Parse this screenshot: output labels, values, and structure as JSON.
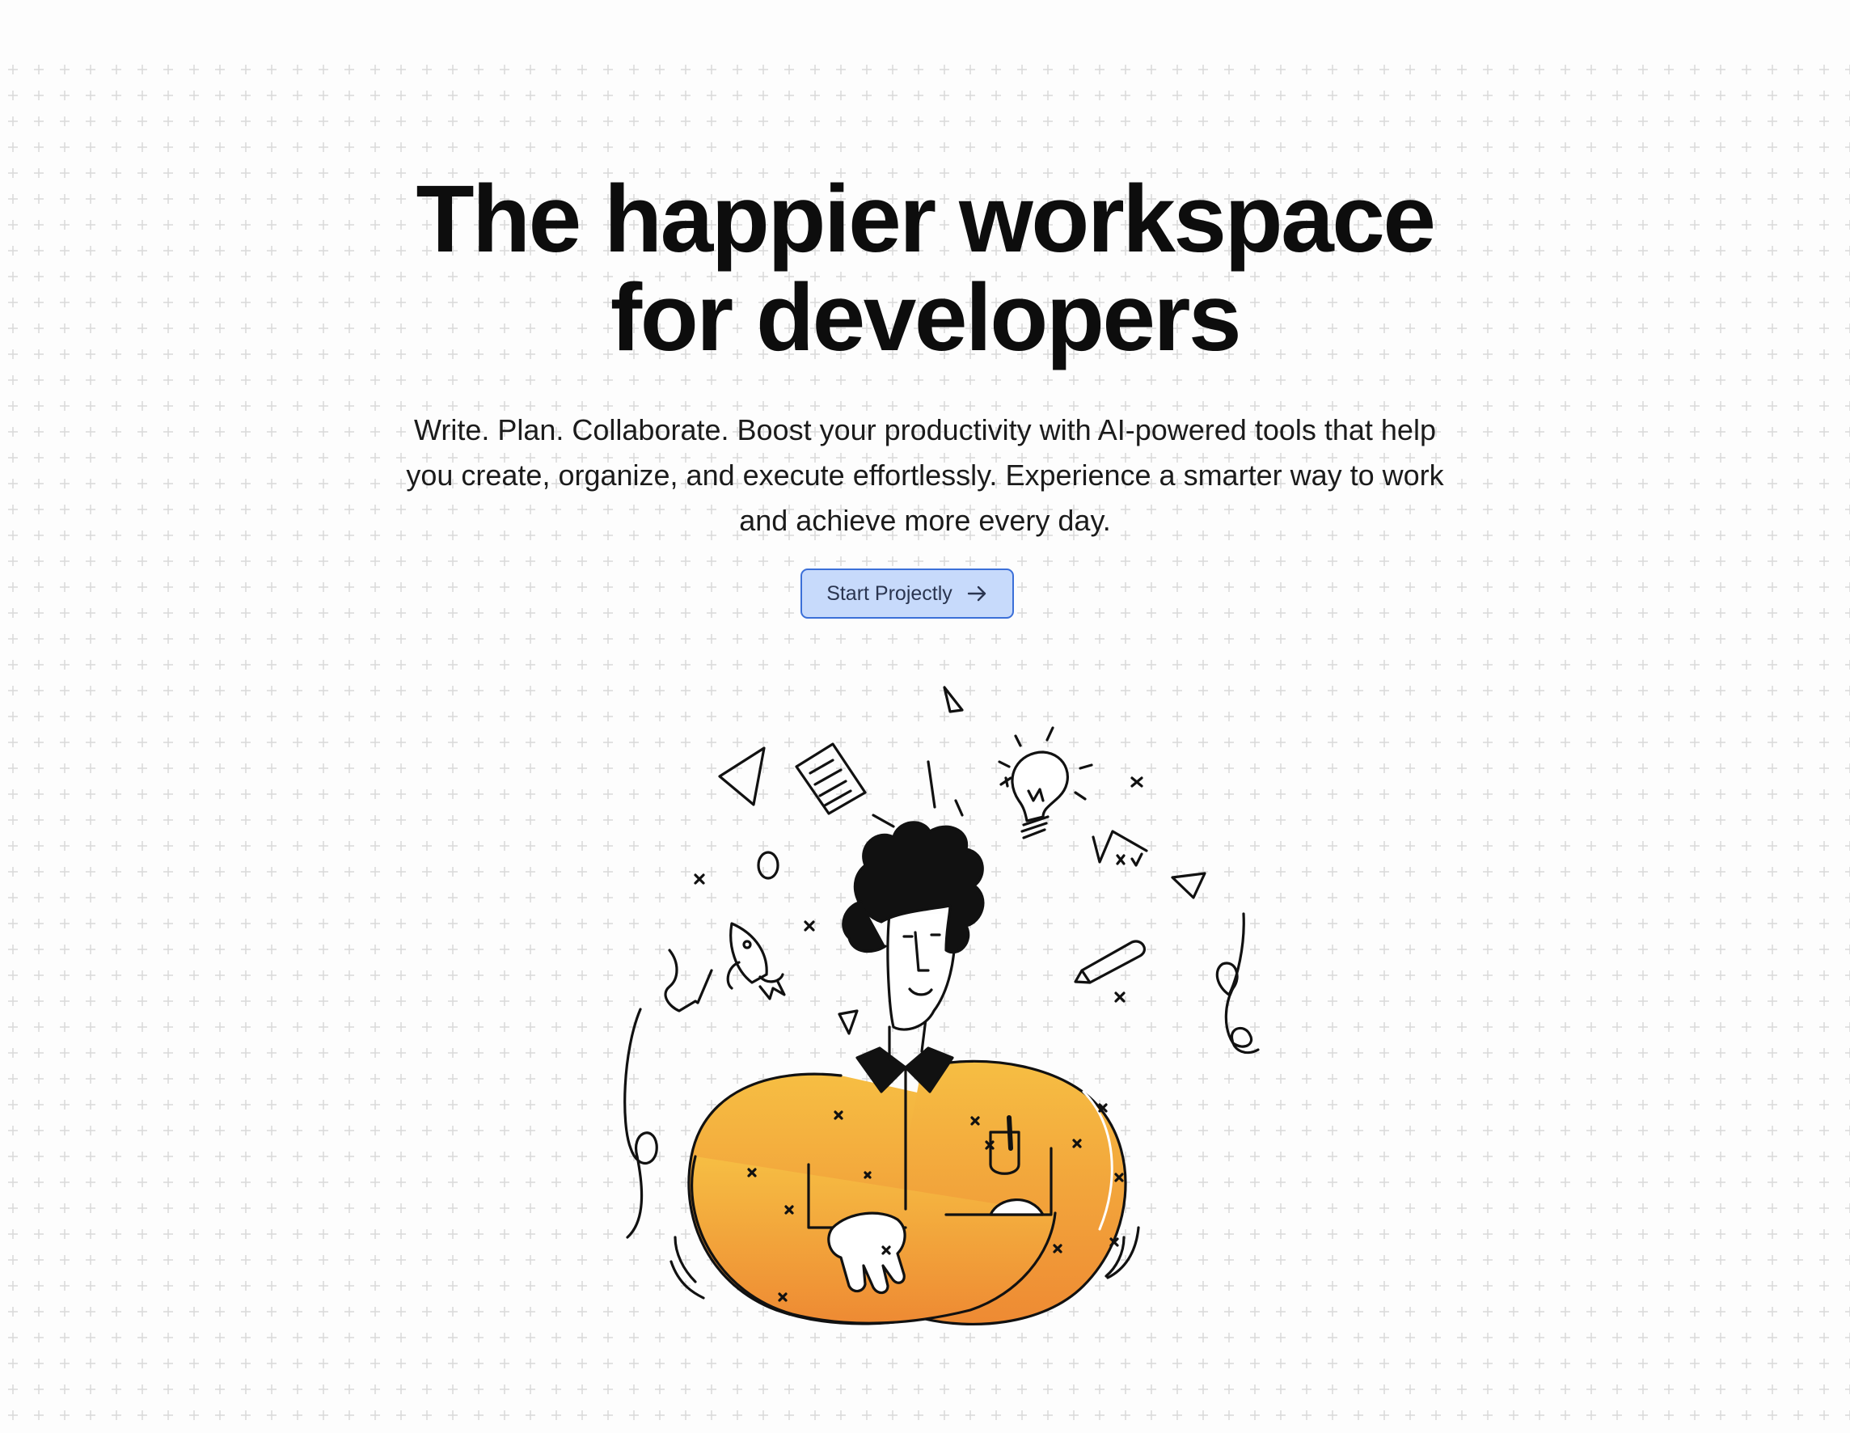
{
  "hero": {
    "headline_line1": "The happier workspace",
    "headline_line2": "for developers",
    "subtitle_line1": "Write. Plan. Collaborate. Boost your productivity with AI-powered tools that help",
    "subtitle_line2": "you create, organize, and execute effortlessly. Experience a smarter way to work",
    "subtitle_line3": "and achieve more every day.",
    "cta_label": "Start Projectly"
  },
  "icons": {
    "cta_icon": "arrow-right-icon",
    "illustration": "developer-illustration"
  },
  "colors": {
    "background": "#fdfdfd",
    "grid": "#d9d9d9",
    "cta_background": "#c7dafb",
    "cta_border": "#3b6fd8",
    "body_orange": "#f4a23a",
    "line": "#111111"
  }
}
